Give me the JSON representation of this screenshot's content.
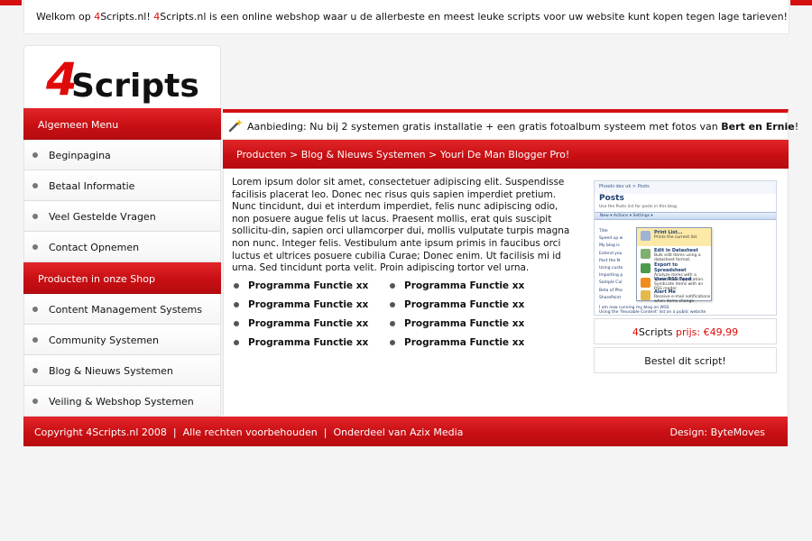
{
  "welcome": {
    "prefix": "Welkom op ",
    "brand1": "4",
    "site1": "Scripts.nl! ",
    "brand2": "4",
    "site2": "Scripts.nl is een online webshop waar u de allerbeste en meest leuke scripts voor uw website kunt kopen tegen lage tarieven!"
  },
  "logo": {
    "digit": "4",
    "word": "Scripts"
  },
  "sidebar": {
    "menu_title": "Algemeen Menu",
    "menu_items": [
      {
        "label": "Beginpagina"
      },
      {
        "label": "Betaal Informatie"
      },
      {
        "label": "Veel Gestelde Vragen"
      },
      {
        "label": "Contact Opnemen"
      }
    ],
    "shop_title": "Producten in onze Shop",
    "shop_items": [
      {
        "label": "Content Management Systems"
      },
      {
        "label": "Community Systemen"
      },
      {
        "label": "Blog & Nieuws Systemen"
      },
      {
        "label": "Veiling & Webshop Systemen"
      }
    ]
  },
  "offer": {
    "text": "Aanbieding: Nu bij 2 systemen gratis installatie + een gratis fotoalbum systeem met fotos van ",
    "bold": "Bert en Ernie",
    "end": "!"
  },
  "breadcrumb": "Producten > Blog & Nieuws Systemen > Youri De Man Blogger Pro!",
  "description": "Lorem ipsum dolor sit amet, consectetuer adipiscing elit. Suspendisse facilisis placerat leo. Donec nec risus quis sapien imperdiet pretium. Nunc tincidunt, dui et interdum imperdiet, felis nunc adipiscing odio, non posuere augue felis ut lacus. Praesent mollis, erat quis suscipit sollicitu-din, sapien orci ullamcorper dui, mollis vulputate turpis magna non nunc. Integer felis. Vestibulum ante ipsum primis in faucibus orci luctus et ultrices posuere cubilia Curae; Donec enim. Ut facilisis mi id urna. Sed tincidunt porta velit. Proin adipiscing tortor vel urna.",
  "features": [
    "Programma Functie xx",
    "Programma Functie xx",
    "Programma Functie xx",
    "Programma Functie xx",
    "Programma Functie xx",
    "Programma Functie xx",
    "Programma Functie xx",
    "Programma Functie xx"
  ],
  "screenshot": {
    "breadcrumb": "Phoebi dev uk > Posts",
    "title": "Posts",
    "subtitle": "Use the Posts list for posts in this blog.",
    "toolbar": "New ▾   Actions ▾   Settings ▾",
    "list": [
      "Title",
      "Speed up w",
      "My blog is",
      "Extend you",
      "Post the N",
      "Using custo",
      "Importing p",
      "Sample Cul",
      "Beta of Pho",
      "SharePoint",
      "I am now running my blog on WSS",
      "Using the 'Reusable Content' list on a public website"
    ],
    "menu": [
      {
        "title": "Print List...",
        "desc": "Prints the current list"
      },
      {
        "title": "Edit in Datasheet",
        "desc": "Bulk edit items using a datasheet format."
      },
      {
        "title": "Export to Spreadsheet",
        "desc": "Analyze items with a spreadsheet application."
      },
      {
        "title": "View RSS Feed",
        "desc": "Syndicate items with an RSS reader."
      },
      {
        "title": "Alert Me",
        "desc": "Receive e-mail notifications when items change."
      }
    ]
  },
  "price": {
    "brand": "4",
    "name": "Scripts",
    "label": " prijs: ",
    "value": "€49,99"
  },
  "buy_label": "Bestel dit script!",
  "footer": {
    "copyright": "Copyright 4Scripts.nl 2008",
    "rights": "Alle rechten voorbehouden",
    "part_of": "Onderdeel van Azix Media",
    "design": "Design: ByteMoves"
  },
  "colors": {
    "accent": "#d40f13",
    "background": "#f4f4f4"
  }
}
